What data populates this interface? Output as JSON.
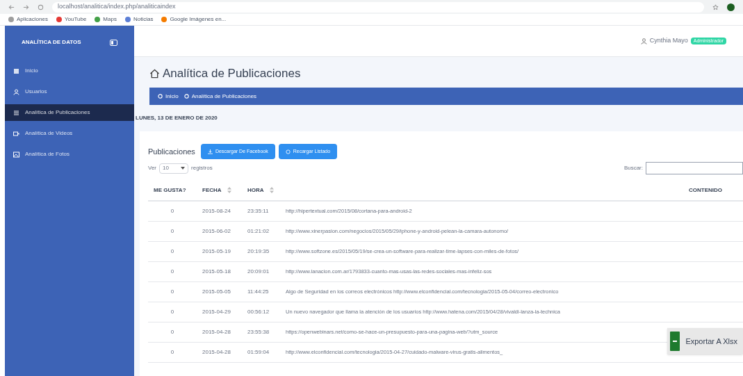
{
  "browser": {
    "url": "localhost/analitica/index.php/analiticaindex",
    "bookmarks": [
      {
        "label": "Aplicaciones",
        "color": "#9e9e9e"
      },
      {
        "label": "YouTube",
        "color": "#e53935"
      },
      {
        "label": "Maps",
        "color": "#43a047"
      },
      {
        "label": "Noticias",
        "color": "#5c7fd6"
      },
      {
        "label": "Google Imágenes en...",
        "color": "#f57c00"
      }
    ]
  },
  "sidebar": {
    "brand": "ANALÍTICA DE DATOS",
    "items": [
      {
        "label": "Inicio",
        "selected": false
      },
      {
        "label": "Usuarios",
        "selected": false
      },
      {
        "label": "Analítica de Publicaciones",
        "selected": true
      },
      {
        "label": "Analítica de Videos",
        "selected": false
      },
      {
        "label": "Analítica de Fotos",
        "selected": false
      }
    ]
  },
  "user": {
    "name": "Cynthia Mayo",
    "badge": "Administrador"
  },
  "page": {
    "title": "Analítica de Publicaciones",
    "breadcrumb": [
      "Inicio",
      "Analítica de Publicaciones"
    ],
    "date": "LUNES, 13 DE ENERO DE 2020"
  },
  "card": {
    "title": "Publicaciones",
    "buttons": [
      "Descargar De Facebook",
      "Recargar Listado"
    ],
    "length_label_before": "Ver",
    "length_value": "10",
    "length_label_after": "registros",
    "search_label": "Buscar:"
  },
  "table": {
    "columns": [
      "ME GUSTA?",
      "FECHA",
      "HORA",
      "CONTENIDO"
    ],
    "rows": [
      {
        "likes": "0",
        "date": "2015-08-24",
        "time": "23:35:11",
        "content": "http://hipertextual.com/2015/08/cortana-para-android-2"
      },
      {
        "likes": "0",
        "date": "2015-06-02",
        "time": "01:21:02",
        "content": "http://www.xinerpasion.com/negocios/2015/05/29/iphone-y-android-pelean-la-camara-autonomo/"
      },
      {
        "likes": "0",
        "date": "2015-05-19",
        "time": "20:19:35",
        "content": "http://www.softzone.es/2015/05/19/se-crea-un-software-para-realizar-time-lapses-con-miles-de-fotos/"
      },
      {
        "likes": "0",
        "date": "2015-05-18",
        "time": "20:09:01",
        "content": "http://www.lanacion.com.ar/1793833-cuanto-mas-usas-las-redes-sociales-mas-infeliz-sos"
      },
      {
        "likes": "0",
        "date": "2015-05-05",
        "time": "11:44:25",
        "content": "Algo de Seguridad en los correos electrónicos http://www.elconfidencial.com/tecnologia/2015-05-04/correo-electronico"
      },
      {
        "likes": "0",
        "date": "2015-04-29",
        "time": "00:56:12",
        "content": "Un nuevo navegador que llama la atención de los usuarios http://www.hatena.com/2015/04/28/vivaldi-lanza-la-technica"
      },
      {
        "likes": "0",
        "date": "2015-04-28",
        "time": "23:55:38",
        "content": "https://openwebinars.net/como-se-hace-un-presupuesto-para-una-pagina-web/?utm_source"
      },
      {
        "likes": "0",
        "date": "2015-04-28",
        "time": "01:59:04",
        "content": "http://www.elconfidencial.com/tecnologia/2015-04-27/cuidado-malware-virus-gratis-alimentos_"
      }
    ]
  },
  "export_button": "Exportar A Xlsx"
}
